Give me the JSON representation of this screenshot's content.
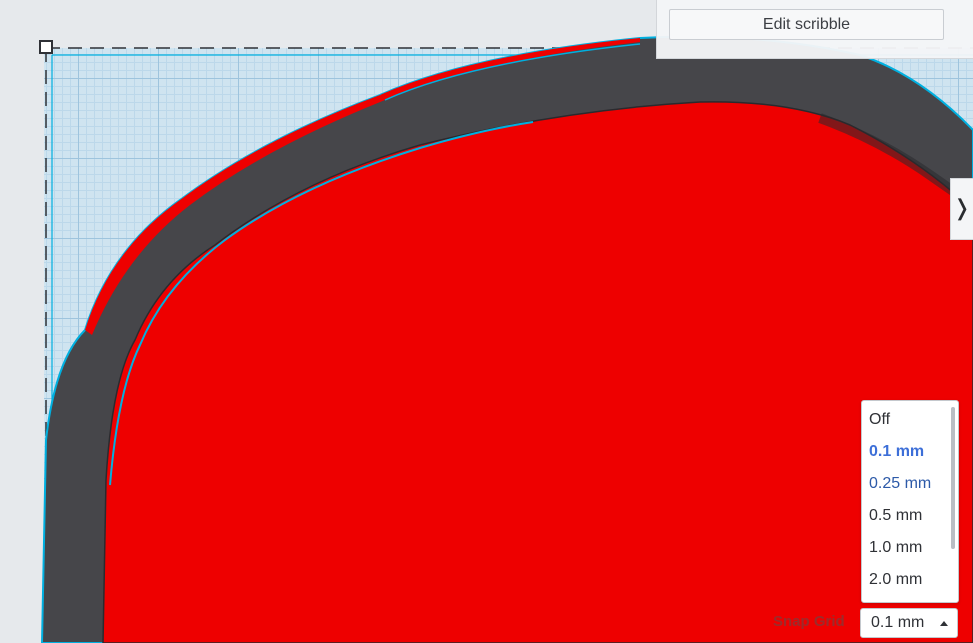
{
  "edit_panel": {
    "edit_button_label": "Edit scribble"
  },
  "side_panel": {
    "toggle_glyph": "❭"
  },
  "snap_grid": {
    "label": "Snap Grid",
    "selected_value": "0.1 mm",
    "options": [
      "Off",
      "0.1 mm",
      "0.25 mm",
      "0.5 mm",
      "1.0 mm",
      "2.0 mm"
    ]
  },
  "colors": {
    "shape_fill": "#ee0000",
    "shape_rim": "#46464a",
    "selection_outline": "#00b0e0",
    "selected_option": "#3d6fd8"
  }
}
